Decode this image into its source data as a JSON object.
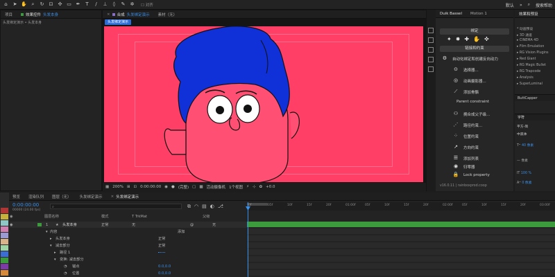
{
  "toolbar": {
    "workspace_default": "默认",
    "search_help": "搜索帮助",
    "snap_label": "对齐",
    "icons": [
      "home-icon",
      "arrow-icon",
      "hand-icon",
      "zoom-icon",
      "rotate-icon",
      "camera-icon",
      "pan-icon",
      "rect-icon",
      "pen-icon",
      "text-icon",
      "brush-icon",
      "stamp-icon",
      "eraser-icon",
      "roto-icon",
      "puppet-icon"
    ]
  },
  "left_panel": {
    "tab_project": "项目",
    "tab_effects": "效果控件",
    "tab_effects_target": "头发本身",
    "breadcrumb": "头发绑定演示 • 头发本身"
  },
  "comp_viewer": {
    "tab_label": "合成",
    "tab_name": "头发绑定演示",
    "tab_footage": "素材（无）",
    "active_chip": "头发绑定演示",
    "zoom": "200%",
    "timecode": "0:00:00:00",
    "resolution": "(完整)",
    "camera": "活动摄像机",
    "views": "1个视图",
    "exposure": "+0.0"
  },
  "duik": {
    "tab_label": "Duik Bassel",
    "tab_motion": "Motion 1",
    "section_bind": "绑定",
    "section_create": "链接和约束",
    "auto_bind": "自动化绑定和创建反向动力",
    "items": [
      {
        "icon": "selector-icon",
        "label": "选择器..."
      },
      {
        "icon": "animation-layer-icon",
        "label": "动画摄影器..."
      },
      {
        "icon": "bone-icon",
        "label": "添加骨骼"
      },
      {
        "icon": "",
        "label": "Parent constraint"
      },
      {
        "icon": "parent-icon",
        "label": "拥合成父子级..."
      },
      {
        "icon": "path-icon",
        "label": "路径约束..."
      },
      {
        "icon": "position-icon",
        "label": "位置约束"
      },
      {
        "icon": "direction-icon",
        "label": "方向约束"
      },
      {
        "icon": "list-icon",
        "label": "添加列表"
      },
      {
        "icon": "zero-icon",
        "label": "归零器"
      },
      {
        "icon": "lock-icon",
        "label": "Lock property"
      }
    ],
    "footer": "v16.0.11 | rainboxprod.coop"
  },
  "right_col": {
    "tab_effects": "效果和预设",
    "effects": [
      "* 动画预设",
      "▸ 3D 通道",
      "▸ CINEMA 4D",
      "▸ Film Emulation",
      "▸ RG Vision Plugins",
      "▸ Red Giant",
      "▸ RG Magic Bullet",
      "▸ RG Trapcode",
      "▸ Analysis",
      "▸ SuperLuminal"
    ],
    "buttcapper": "ButtCapper",
    "tab_char": "字符",
    "font": "平方-简",
    "style": "中黑体",
    "size": "40 像素",
    "leading": "— 像素",
    "scale": "100 %",
    "baseline": "0 像素"
  },
  "timeline": {
    "tabs": [
      {
        "label": "预览"
      },
      {
        "label": "渲染队列"
      },
      {
        "label": "图层（无）"
      },
      {
        "label": "头发绑定演示"
      },
      {
        "label": "头发绑定演示"
      }
    ],
    "timecode": "0:00:00:00",
    "fps": "00000 (24.00 fps)",
    "columns": {
      "name": "图层名称",
      "mode": "模式",
      "trkmat": "T TrkMat",
      "parent": "父级"
    },
    "rows": [
      {
        "num": "1",
        "name": "头发本身",
        "mode": "正常",
        "trk": "无",
        "parent": "无"
      },
      {
        "name": "内容",
        "extra": "添加"
      },
      {
        "name": "头发本身",
        "mode": "正常"
      },
      {
        "name": "减去部分",
        "mode": "正常"
      },
      {
        "name": "路径 1"
      },
      {
        "name": "变换: 减去部分"
      },
      {
        "name": "锚点",
        "value": "0.0,0.0"
      },
      {
        "name": "位置",
        "value": "0.0,0.0"
      }
    ],
    "ruler_ticks": [
      "0f",
      "05f",
      "10f",
      "15f",
      "20f",
      "01:00f",
      "05f",
      "10f",
      "15f",
      "20f",
      "02:00f",
      "05f",
      "10f",
      "15f",
      "20f",
      "03:00f"
    ]
  }
}
